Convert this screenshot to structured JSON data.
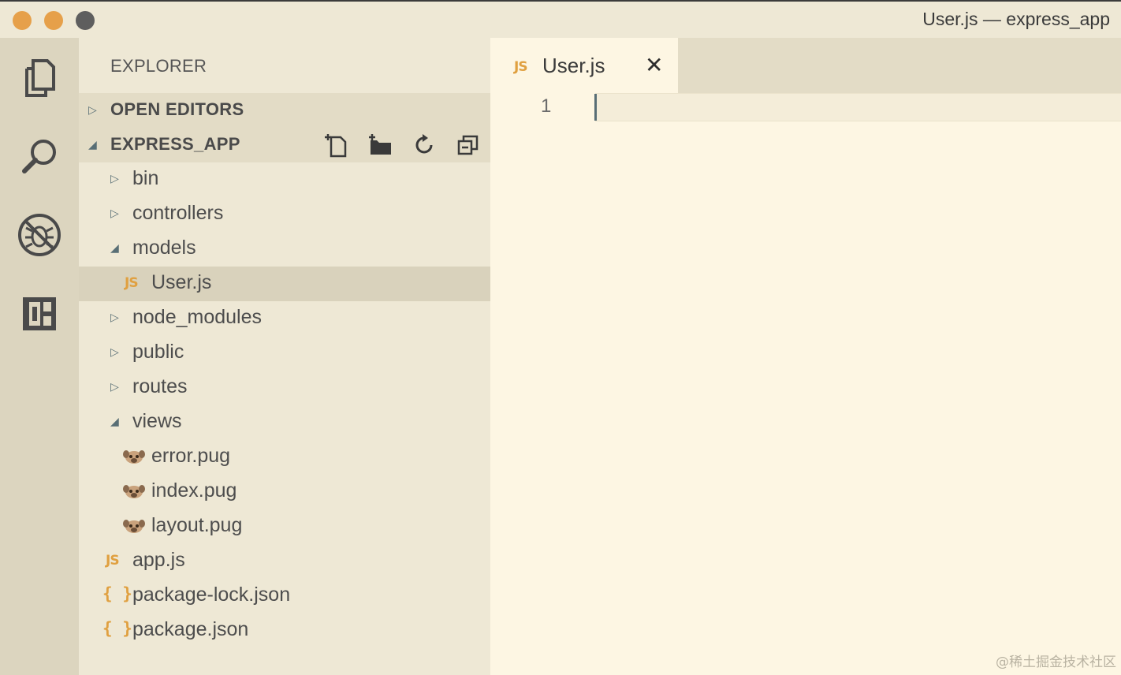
{
  "window": {
    "title": "User.js — express_app"
  },
  "activity_bar": {
    "items": [
      {
        "name": "explorer",
        "icon": "files-icon"
      },
      {
        "name": "search",
        "icon": "search-icon"
      },
      {
        "name": "debug",
        "icon": "no-bug-icon"
      },
      {
        "name": "extensions",
        "icon": "extensions-icon"
      }
    ]
  },
  "sidebar": {
    "title": "EXPLORER",
    "open_editors": {
      "label": "OPEN EDITORS",
      "expanded": false
    },
    "project": {
      "label": "EXPRESS_APP",
      "expanded": true,
      "actions": [
        "new-file-icon",
        "new-folder-icon",
        "refresh-icon",
        "collapse-all-icon"
      ]
    },
    "tree": [
      {
        "label": "bin",
        "type": "folder",
        "expanded": false,
        "depth": 1
      },
      {
        "label": "controllers",
        "type": "folder",
        "expanded": false,
        "depth": 1
      },
      {
        "label": "models",
        "type": "folder",
        "expanded": true,
        "depth": 1
      },
      {
        "label": "User.js",
        "type": "js",
        "depth": 2,
        "selected": true
      },
      {
        "label": "node_modules",
        "type": "folder",
        "expanded": false,
        "depth": 1
      },
      {
        "label": "public",
        "type": "folder",
        "expanded": false,
        "depth": 1
      },
      {
        "label": "routes",
        "type": "folder",
        "expanded": false,
        "depth": 1
      },
      {
        "label": "views",
        "type": "folder",
        "expanded": true,
        "depth": 1
      },
      {
        "label": "error.pug",
        "type": "pug",
        "depth": 2
      },
      {
        "label": "index.pug",
        "type": "pug",
        "depth": 2
      },
      {
        "label": "layout.pug",
        "type": "pug",
        "depth": 2
      },
      {
        "label": "app.js",
        "type": "js",
        "depth": 1
      },
      {
        "label": "package-lock.json",
        "type": "json",
        "depth": 1
      },
      {
        "label": "package.json",
        "type": "json",
        "depth": 1
      }
    ]
  },
  "editor": {
    "tab": {
      "label": "User.js",
      "icon_text": "JS",
      "close": "✕"
    },
    "lines": [
      "1"
    ]
  },
  "file_icons": {
    "js": "JS",
    "json": "{ }"
  },
  "colors": {
    "js_accent": "#e0a040",
    "sidebar_bg": "#eee8d5",
    "editor_bg": "#fdf6e3"
  },
  "watermark": "@稀土掘金技术社区"
}
